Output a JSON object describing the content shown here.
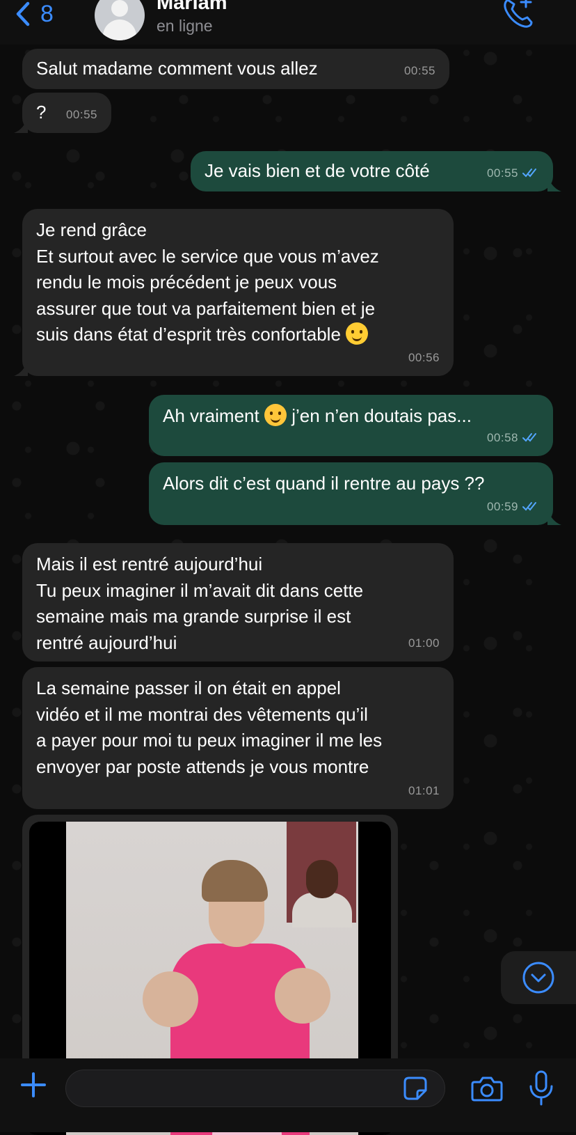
{
  "header": {
    "back_count": "8",
    "contact_name": "Mariam",
    "status": "en ligne"
  },
  "messages": [
    {
      "dir": "in",
      "text": "Salut madame comment vous allez",
      "time": "00:55"
    },
    {
      "dir": "in",
      "text": "?",
      "time": "00:55"
    },
    {
      "dir": "out",
      "text": "Je vais bien et de votre côté",
      "time": "00:55",
      "read": true
    },
    {
      "dir": "in",
      "text_lines": [
        "Je rend grâce",
        "Et surtout avec le service que vous m’avez",
        "rendu le mois précédent je peux vous",
        "assurer que tout va parfaitement bien et je",
        "suis dans état d’esprit très confortable"
      ],
      "emoji": "slightly-smiling-face",
      "time": "00:56"
    },
    {
      "dir": "out",
      "text_before": "Ah vraiment",
      "emoji": "smiling-face-with-smiling-eyes",
      "text_after": "j’en n’en doutais pas...",
      "time": "00:58",
      "read": true
    },
    {
      "dir": "out",
      "text": "Alors dit c’est quand il rentre au pays ??",
      "time": "00:59",
      "read": true
    },
    {
      "dir": "in",
      "text_lines": [
        "Mais il est rentré aujourd’hui",
        "Tu peux imaginer il m’avait dit dans cette",
        "semaine mais ma grande surprise il est",
        "rentré aujourd’hui"
      ],
      "time": "01:00"
    },
    {
      "dir": "in",
      "text_lines": [
        "La semaine passer il on était en appel",
        "vidéo et il me montrai des vêtements qu’il",
        "a payer pour moi tu peux imaginer il me les",
        "envoyer par poste attends je vous montre"
      ],
      "time": "01:01"
    },
    {
      "dir": "in",
      "type": "image",
      "description": "video-call-screenshot"
    }
  ],
  "composer": {
    "text": ""
  },
  "colors": {
    "accent": "#3b8cff",
    "incoming_bubble": "#252525",
    "outgoing_bubble": "#1d4a3d",
    "read_ticks": "#53a6ff"
  },
  "icons": [
    "chevron-left-icon",
    "add-call-icon",
    "plus-icon",
    "sticker-icon",
    "camera-icon",
    "microphone-icon",
    "chevron-down-icon"
  ]
}
